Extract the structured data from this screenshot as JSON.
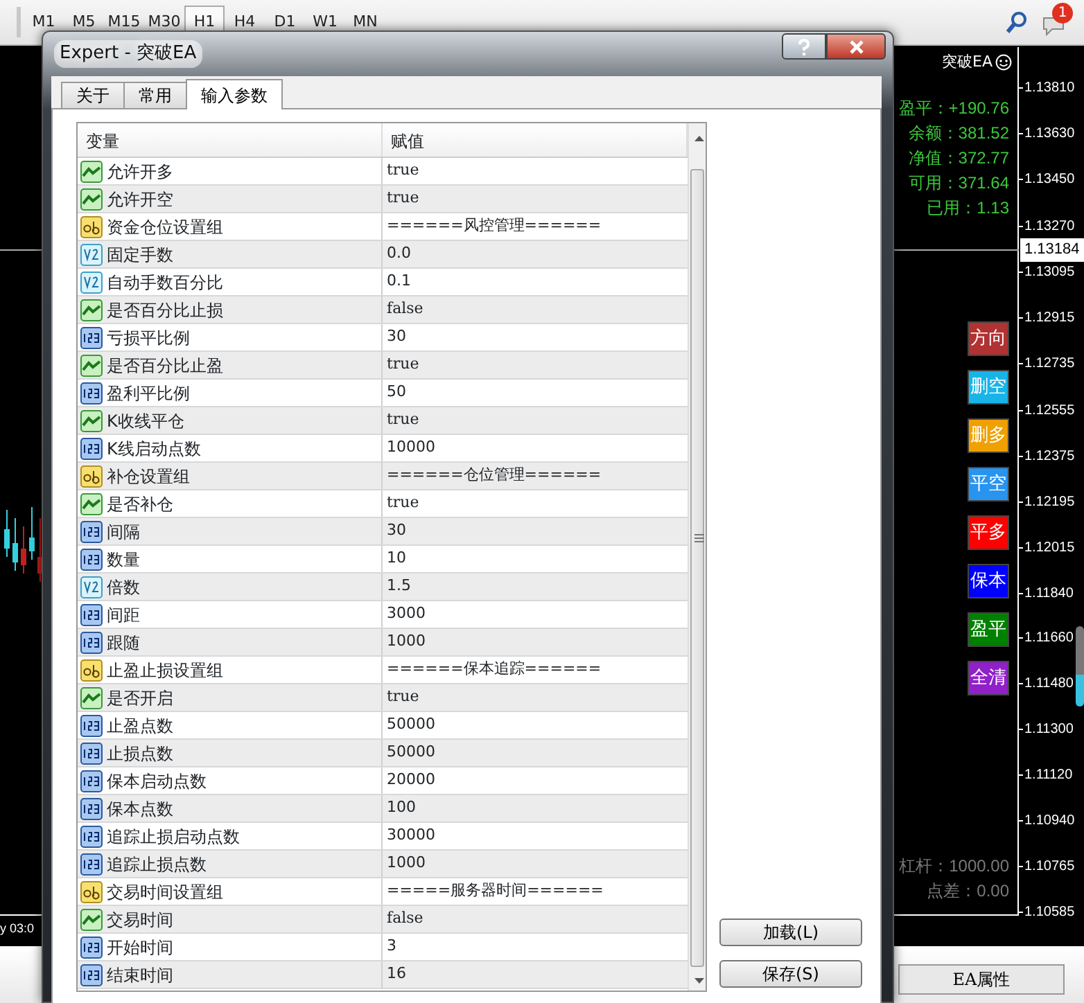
{
  "toolbar": {
    "timeframes": [
      {
        "label": "M1",
        "selected": false
      },
      {
        "label": "M5",
        "selected": false
      },
      {
        "label": "M15",
        "selected": false
      },
      {
        "label": "M30",
        "selected": false
      },
      {
        "label": "H1",
        "selected": true
      },
      {
        "label": "H4",
        "selected": false
      },
      {
        "label": "D1",
        "selected": false
      },
      {
        "label": "W1",
        "selected": false
      },
      {
        "label": "MN",
        "selected": false
      }
    ],
    "notification_count": "1"
  },
  "chart": {
    "time_label": "y 03:0",
    "ea_name": "突破EA",
    "stats": [
      "盈平：+190.76",
      "余额：381.52",
      "净值：372.77",
      "可用：371.64",
      "已用：1.13"
    ],
    "prices": [
      "1.13810",
      "1.13630",
      "1.13450",
      "1.13270",
      "1.13095",
      "1.12915",
      "1.12735",
      "1.12555",
      "1.12375",
      "1.12195",
      "1.12015",
      "1.11840",
      "1.11660",
      "1.11480",
      "1.11300",
      "1.11120",
      "1.10940",
      "1.10765",
      "1.10585"
    ],
    "current_price": "1.13184",
    "buttons": [
      {
        "label": "方向",
        "color": "#b03232"
      },
      {
        "label": "删空",
        "color": "#18b4e8"
      },
      {
        "label": "删多",
        "color": "#f0a000"
      },
      {
        "label": "平空",
        "color": "#2894f0"
      },
      {
        "label": "平多",
        "color": "#ff0000"
      },
      {
        "label": "保本",
        "color": "#0000ff"
      },
      {
        "label": "盈平",
        "color": "#008000"
      },
      {
        "label": "全清",
        "color": "#9020c8"
      }
    ],
    "footer_stats": [
      "杠杆：1000.00",
      "点差：0.00"
    ]
  },
  "dialog": {
    "title": "Expert - 突破EA",
    "tabs": [
      {
        "label": "关于",
        "selected": false
      },
      {
        "label": "常用",
        "selected": false
      },
      {
        "label": "输入参数",
        "selected": true
      }
    ],
    "columns": [
      "变量",
      "赋值"
    ],
    "rows": [
      {
        "kind": "bool",
        "name": "允许开多",
        "value": "true"
      },
      {
        "kind": "bool",
        "name": "允许开空",
        "value": "true"
      },
      {
        "kind": "string",
        "name": "资金仓位设置组",
        "value": "======风控管理======"
      },
      {
        "kind": "double",
        "name": "固定手数",
        "value": "0.0"
      },
      {
        "kind": "double",
        "name": "自动手数百分比",
        "value": "0.1"
      },
      {
        "kind": "bool",
        "name": "是否百分比止损",
        "value": "false"
      },
      {
        "kind": "int",
        "name": "亏损平比例",
        "value": "30"
      },
      {
        "kind": "bool",
        "name": "是否百分比止盈",
        "value": "true"
      },
      {
        "kind": "int",
        "name": "盈利平比例",
        "value": "50"
      },
      {
        "kind": "bool",
        "name": "K收线平仓",
        "value": "true"
      },
      {
        "kind": "int",
        "name": "K线启动点数",
        "value": "10000"
      },
      {
        "kind": "string",
        "name": "补仓设置组",
        "value": "======仓位管理======"
      },
      {
        "kind": "bool",
        "name": "是否补仓",
        "value": "true"
      },
      {
        "kind": "int",
        "name": "间隔",
        "value": "30"
      },
      {
        "kind": "int",
        "name": "数量",
        "value": "10"
      },
      {
        "kind": "double",
        "name": "倍数",
        "value": "1.5"
      },
      {
        "kind": "int",
        "name": "间距",
        "value": "3000"
      },
      {
        "kind": "int",
        "name": "跟随",
        "value": "1000"
      },
      {
        "kind": "string",
        "name": "止盈止损设置组",
        "value": "======保本追踪======"
      },
      {
        "kind": "bool",
        "name": "是否开启",
        "value": "true"
      },
      {
        "kind": "int",
        "name": "止盈点数",
        "value": "50000"
      },
      {
        "kind": "int",
        "name": "止损点数",
        "value": "50000"
      },
      {
        "kind": "int",
        "name": "保本启动点数",
        "value": "20000"
      },
      {
        "kind": "int",
        "name": "保本点数",
        "value": "100"
      },
      {
        "kind": "int",
        "name": "追踪止损启动点数",
        "value": "30000"
      },
      {
        "kind": "int",
        "name": "追踪止损点数",
        "value": "1000"
      },
      {
        "kind": "string",
        "name": "交易时间设置组",
        "value": "=====服务器时间======"
      },
      {
        "kind": "bool",
        "name": "交易时间",
        "value": "false"
      },
      {
        "kind": "int",
        "name": "开始时间",
        "value": "3"
      },
      {
        "kind": "int",
        "name": "结束时间",
        "value": "16"
      }
    ],
    "buttons": [
      "加载(L)",
      "保存(S)"
    ]
  },
  "bottom_button": "EA属性"
}
